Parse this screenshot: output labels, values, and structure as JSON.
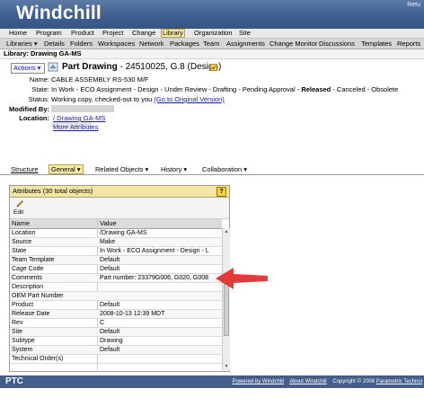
{
  "header": {
    "logo": "Windchill",
    "corner": "Retu"
  },
  "menu": [
    "Home",
    "Program",
    "Product",
    "Project",
    "Change",
    "Library",
    "Organization",
    "Site"
  ],
  "tabs": [
    "Libraries ▾",
    "Details",
    "Folders",
    "Workspaces",
    "Network",
    "Packages",
    "Team",
    "Assignments",
    "Change Monitor",
    "Discussions",
    "Templates",
    "Reports"
  ],
  "context": "Library: Drawing GA-MS",
  "object": {
    "actions_label": "Actions ▾",
    "title_bold": "Part Drawing",
    "title_rest": " - 24510025, G.8 (Design)",
    "name_label": "Name:",
    "name_value": "CABLE ASSEMBLY RS-530 M/F",
    "state_label": "State:",
    "state_pre": "In Work - ECO Assignment - Design - Under Review - Drafting - Pending Approval -",
    "state_current": "Released",
    "state_post": "- Canceled - Obsolete",
    "status_label": "Status:",
    "status_value": "Working copy, checked-out to you ",
    "status_link": "(Go to Original Version)",
    "modified_label": "Modified By:",
    "location_label": "Location:",
    "location_link": "/ Drawing GA-MS",
    "more_link": "More Attributes"
  },
  "subtabs": [
    "Structure",
    "General ▾",
    "Related Objects ▾",
    "History ▾",
    "Collaboration ▾"
  ],
  "attributes": {
    "title": "Attributes (30 total objects)",
    "help": "?",
    "edit_label": "Edit",
    "col_name": "Name",
    "col_value": "Value",
    "rows": [
      {
        "name": "Location",
        "value": "/Drawing GA-MS"
      },
      {
        "name": "Source",
        "value": "Make"
      },
      {
        "name": "State",
        "value": "In Work - ECO Assignment - Design - L"
      },
      {
        "name": "Team Template",
        "value": "Default"
      },
      {
        "name": "Cage Code",
        "value": "Default"
      },
      {
        "name": "Comments",
        "value": "Part number: 23379G006, G020, G008"
      },
      {
        "name": "Description",
        "value": ""
      },
      {
        "name": "OEM Part Number",
        "value": ""
      },
      {
        "name": "Product",
        "value": "Default"
      },
      {
        "name": "Release Date",
        "value": "2008-10-13 12:39 MDT"
      },
      {
        "name": "Rev",
        "value": "C"
      },
      {
        "name": "Site",
        "value": "Default"
      },
      {
        "name": "Subtype",
        "value": "Drawing"
      },
      {
        "name": "System",
        "value": "Default"
      },
      {
        "name": "Technical Order(s)",
        "value": ""
      }
    ]
  },
  "footer": {
    "ptc": "PTC",
    "powered": "Powered by Windchill",
    "about": "About Windchill",
    "copyright": "Copyright © 2008 ",
    "param": "Parametric Technol"
  },
  "colors": {
    "banner": "#3f5f8f",
    "highlight": "#f7e9a6",
    "arrow": "#e53a3a",
    "footer": "#435e8b"
  }
}
